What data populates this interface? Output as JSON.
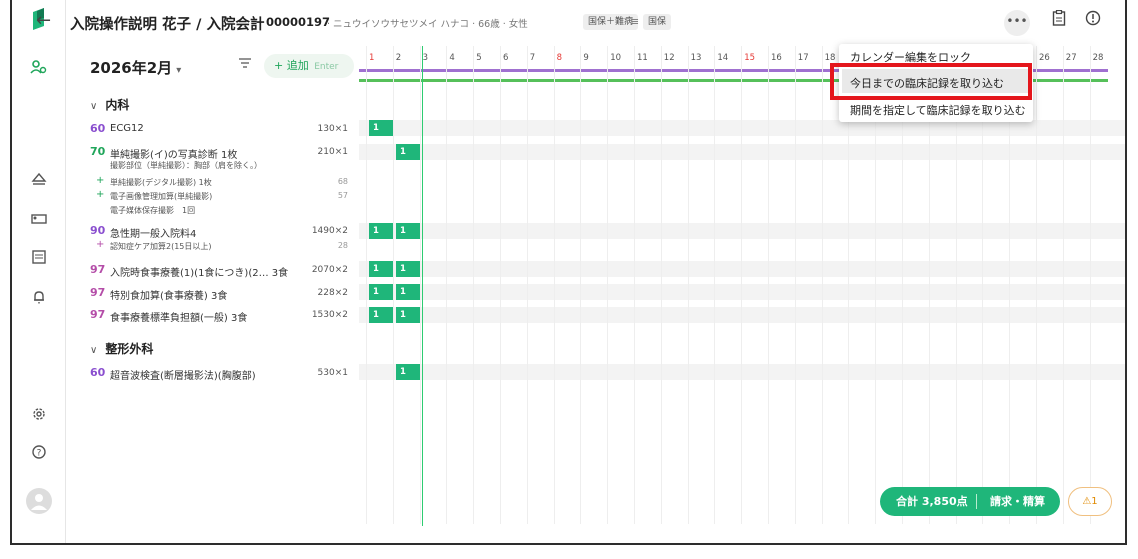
{
  "header": {
    "title": "入院操作説明 花子 / 入院会計",
    "patient_id": "00000197",
    "patient_info": "· ニュウイソウサセツメイ ハナコ · 66歳 · 女性",
    "tags": [
      "国保＋難病",
      "国保"
    ]
  },
  "toolbar": {
    "month": "2026年2月",
    "add_label": "+ 追加",
    "add_hint": "Enter"
  },
  "calendar": {
    "days": [
      "1",
      "2",
      "3",
      "4",
      "5",
      "6",
      "7",
      "8",
      "9",
      "10",
      "11",
      "12",
      "13",
      "14",
      "15",
      "16",
      "17",
      "18",
      "",
      "",
      "",
      "",
      "",
      "",
      "",
      "26",
      "27",
      "28"
    ],
    "red_days": [
      "1",
      "8",
      "15"
    ]
  },
  "sections": [
    {
      "label": "内科"
    },
    {
      "label": "整形外科"
    }
  ],
  "rows": [
    {
      "num": "60",
      "name": "ECG12",
      "qty": "130×1"
    },
    {
      "num": "70",
      "name": "単純撮影(イ)の写真診断 1枚",
      "qty": "210×1"
    },
    {
      "num": "90",
      "name": "急性期一般入院料4",
      "qty": "1490×2"
    },
    {
      "num": "97",
      "name": "入院時食事療養(1)(1食につき)(2… 3食",
      "qty": "2070×2"
    },
    {
      "num": "97",
      "name": "特別食加算(食事療養) 3食",
      "qty": "228×2"
    },
    {
      "num": "97",
      "name": "食事療養標準負担額(一般) 3食",
      "qty": "1530×2"
    },
    {
      "num": "60",
      "name": "超音波検査(断層撮影法)(胸腹部)",
      "qty": "530×1"
    }
  ],
  "subs": {
    "xray_note": "撮影部位（単純撮影）：胸部（肩を除く。）",
    "digital": "単純撮影(デジタル撮影) 1枚",
    "digital_val": "68",
    "image_mgmt": "電子画像管理加算(単純撮影)",
    "image_mgmt_val": "57",
    "media": "電子媒体保存撮影　1回",
    "dementia": "認知症ケア加算2(15日以上)",
    "dementia_val": "28"
  },
  "cell_value": "1",
  "dropdown": {
    "items": [
      "カレンダー編集をロック",
      "今日までの臨床記録を取り込む",
      "期間を指定して臨床記録を取り込む"
    ]
  },
  "footer": {
    "total": "合計 3,850点",
    "bill": "請求・精算",
    "warn": "⚠1"
  },
  "colors": {
    "accent_green": "#1fb67a",
    "highlight_red": "#e4161c",
    "purple_bar": "#a070d0"
  }
}
